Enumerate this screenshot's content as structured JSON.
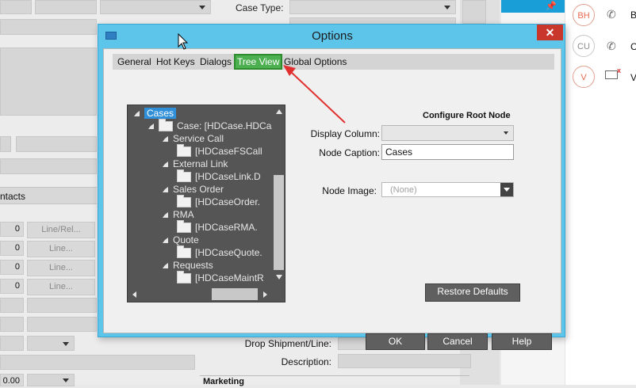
{
  "background": {
    "case_type_label": "Case Type:",
    "contacts_label": "ntacts",
    "rows": [
      {
        "num": "0",
        "btn": "Line/Rel..."
      },
      {
        "num": "0",
        "btn": "Line..."
      },
      {
        "num": "0",
        "btn": "Line..."
      },
      {
        "num": "0",
        "btn": "Line..."
      }
    ],
    "bottom_value": "0.00",
    "drop_shipment_label": "Drop Shipment/Line:",
    "description_label": "Description:",
    "marketing_label": "Marketing",
    "pin_icon": "pin-icon"
  },
  "right_panel": {
    "contacts": [
      {
        "initials": "BH",
        "name": "B"
      },
      {
        "initials": "CU",
        "name": "C"
      },
      {
        "initials": "V",
        "name": "V"
      }
    ]
  },
  "dialog": {
    "title": "Options",
    "close_label": "✕",
    "tabs": [
      "General",
      "Hot Keys",
      "Dialogs",
      "Tree View",
      "Global Options"
    ],
    "active_tab": "Tree View",
    "tree": {
      "items": [
        {
          "label": "Cases",
          "level": 0,
          "expand": true,
          "folder": false,
          "selected": true
        },
        {
          "label": "Case: [HDCase.HDCas",
          "level": 1,
          "expand": true,
          "folder": true,
          "selected": false
        },
        {
          "label": "Service Call",
          "level": 2,
          "expand": true,
          "folder": false,
          "selected": false
        },
        {
          "label": "[HDCaseFSCall",
          "level": 3,
          "expand": false,
          "folder": true,
          "selected": false
        },
        {
          "label": "External Link",
          "level": 2,
          "expand": true,
          "folder": false,
          "selected": false
        },
        {
          "label": "[HDCaseLink.D",
          "level": 3,
          "expand": false,
          "folder": true,
          "selected": false
        },
        {
          "label": "Sales Order",
          "level": 2,
          "expand": true,
          "folder": false,
          "selected": false
        },
        {
          "label": "[HDCaseOrder.",
          "level": 3,
          "expand": false,
          "folder": true,
          "selected": false
        },
        {
          "label": "RMA",
          "level": 2,
          "expand": true,
          "folder": false,
          "selected": false
        },
        {
          "label": "[HDCaseRMA.",
          "level": 3,
          "expand": false,
          "folder": true,
          "selected": false
        },
        {
          "label": "Quote",
          "level": 2,
          "expand": true,
          "folder": false,
          "selected": false
        },
        {
          "label": "[HDCaseQuote.",
          "level": 3,
          "expand": false,
          "folder": true,
          "selected": false
        },
        {
          "label": "Requests",
          "level": 2,
          "expand": true,
          "folder": false,
          "selected": false
        },
        {
          "label": "[HDCaseMaintR",
          "level": 3,
          "expand": false,
          "folder": true,
          "selected": false
        }
      ]
    },
    "configure_title": "Configure Root Node",
    "display_column_label": "Display Column:",
    "display_column_value": "",
    "node_caption_label": "Node Caption:",
    "node_caption_value": "Cases",
    "node_image_label": "Node Image:",
    "node_image_value": "(None)",
    "restore_defaults_label": "Restore Defaults",
    "ok_label": "OK",
    "cancel_label": "Cancel",
    "help_label": "Help"
  },
  "colors": {
    "titlebar": "#5ec5ea",
    "active_tab": "#4caf50",
    "selection": "#2f8fd8",
    "annotation_arrow": "#e03030",
    "close_button": "#c9372c"
  }
}
